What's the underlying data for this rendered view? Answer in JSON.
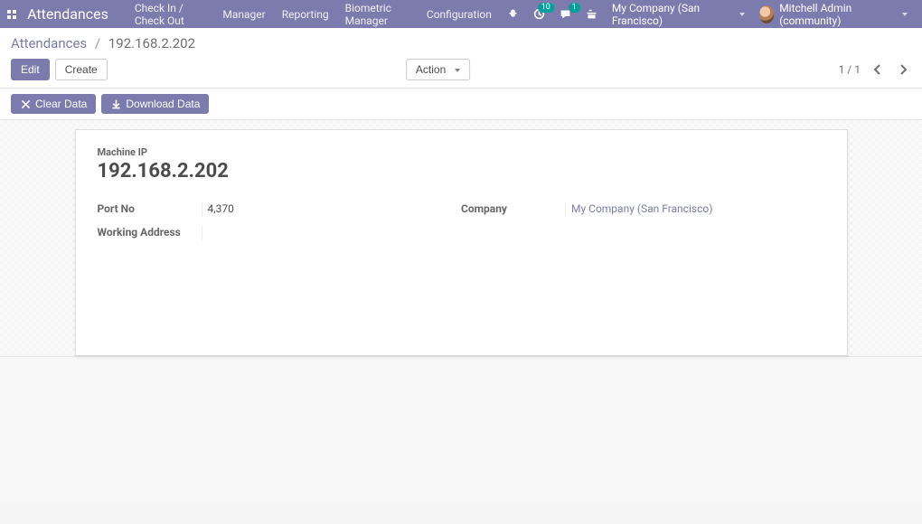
{
  "navbar": {
    "app_title": "Attendances",
    "menu": [
      "Check In / Check Out",
      "Manager",
      "Reporting",
      "Biometric Manager",
      "Configuration"
    ],
    "systray": {
      "activities_badge": "10",
      "messages_badge": "1"
    },
    "company": "My Company (San Francisco)",
    "user": "Mitchell Admin (community)"
  },
  "breadcrumb": {
    "root": "Attendances",
    "current": "192.168.2.202"
  },
  "buttons": {
    "edit": "Edit",
    "create": "Create",
    "action": "Action",
    "clear_data": "Clear Data",
    "download_data": "Download Data"
  },
  "pager": {
    "text": "1 / 1"
  },
  "form": {
    "title_label": "Machine IP",
    "title_value": "192.168.2.202",
    "left": [
      {
        "label": "Port No",
        "value": "4,370"
      },
      {
        "label": "Working Address",
        "value": ""
      }
    ],
    "right": [
      {
        "label": "Company",
        "value": "My Company (San Francisco)",
        "link": true
      }
    ]
  }
}
